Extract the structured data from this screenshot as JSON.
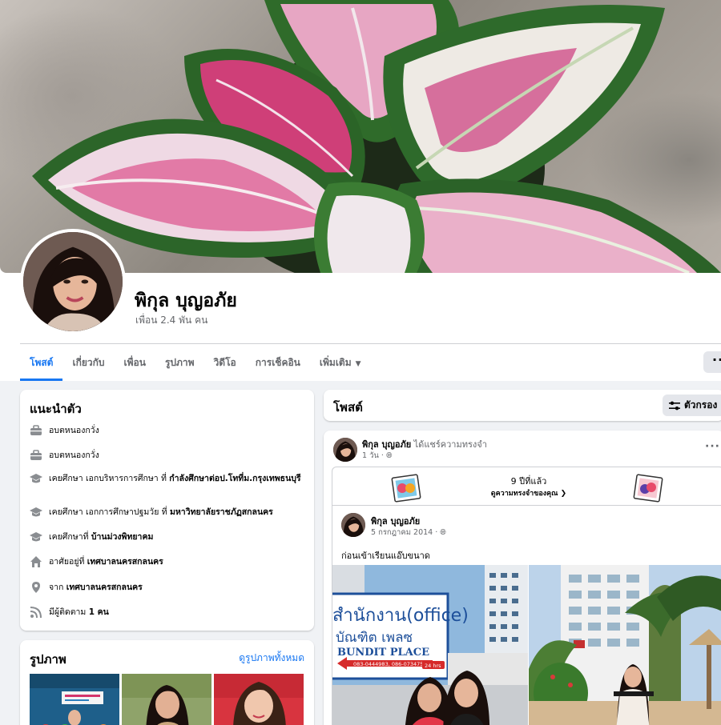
{
  "profile": {
    "name": "พิกุล บุญอภัย",
    "friends": "เพื่อน 2.4 พัน คน"
  },
  "tabs": [
    {
      "label": "โพสต์"
    },
    {
      "label": "เกี่ยวกับ"
    },
    {
      "label": "เพื่อน"
    },
    {
      "label": "รูปภาพ"
    },
    {
      "label": "วิดีโอ"
    },
    {
      "label": "การเช็คอิน"
    },
    {
      "label": "เพิ่มเติม"
    }
  ],
  "more_button": "···",
  "intro": {
    "title": "แนะนำตัว",
    "items": [
      {
        "icon": "briefcase-icon",
        "text": "อบตหนองกวั่ง"
      },
      {
        "icon": "briefcase-icon",
        "text": "อบตหนองกวั่ง"
      },
      {
        "icon": "graduation-cap-icon",
        "prefix": "เคยศึกษา เอกบริหารการศึกษา ที่ ",
        "bold": "กำลังศึกษาต่อป.โทที่ม.กรุงเทพธนบุรี"
      },
      {
        "icon": "graduation-cap-icon",
        "prefix": "เคยศึกษา เอกการศึกษาปฐมวัย ที่ ",
        "bold": "มหาวิทยาลัยราชภัฏสกลนคร"
      },
      {
        "icon": "graduation-cap-icon",
        "prefix": "เคยศึกษาที่ ",
        "bold": "บ้านม่วงพิทยาคม"
      },
      {
        "icon": "home-icon",
        "prefix": "อาศัยอยู่ที่ ",
        "bold": "เทศบาลนครสกลนคร"
      },
      {
        "icon": "location-pin-icon",
        "prefix": "จาก ",
        "bold": "เทศบาลนครสกลนคร"
      },
      {
        "icon": "rss-icon",
        "prefix": "มีผู้ติดตาม ",
        "bold": "1 คน"
      }
    ]
  },
  "photos_card": {
    "title": "รูปภาพ",
    "see_all": "ดูรูปภาพทั้งหมด"
  },
  "posts_header": {
    "title": "โพสต์",
    "filter": "ตัวกรอง"
  },
  "post": {
    "author": "พิกุล บุญอภัย",
    "action": " ได้แชร์ความทรงจำ",
    "time": "1 วัน · ",
    "dots": "···",
    "memory": {
      "years": "9 ปีที่แล้ว",
      "link": "ดูความทรงจำของคุณ ❯"
    },
    "shared": {
      "author": "พิกุล บุญอภัย",
      "time": "5 กรกฎาคม 2014 · ",
      "text": "ก่อนเข้าเรียนแอ๊บขนาด",
      "sign": {
        "line1": "สำนักงาน(office)",
        "line2": "บัณฑิต เพลซ",
        "line3": "BUNDIT PLACE",
        "phone": "083-0444983, 086-0734757",
        "badge": "24 hrs"
      }
    }
  },
  "colors": {
    "accent": "#1877f2",
    "secondary_text": "#65676b",
    "background": "#f0f2f5"
  }
}
